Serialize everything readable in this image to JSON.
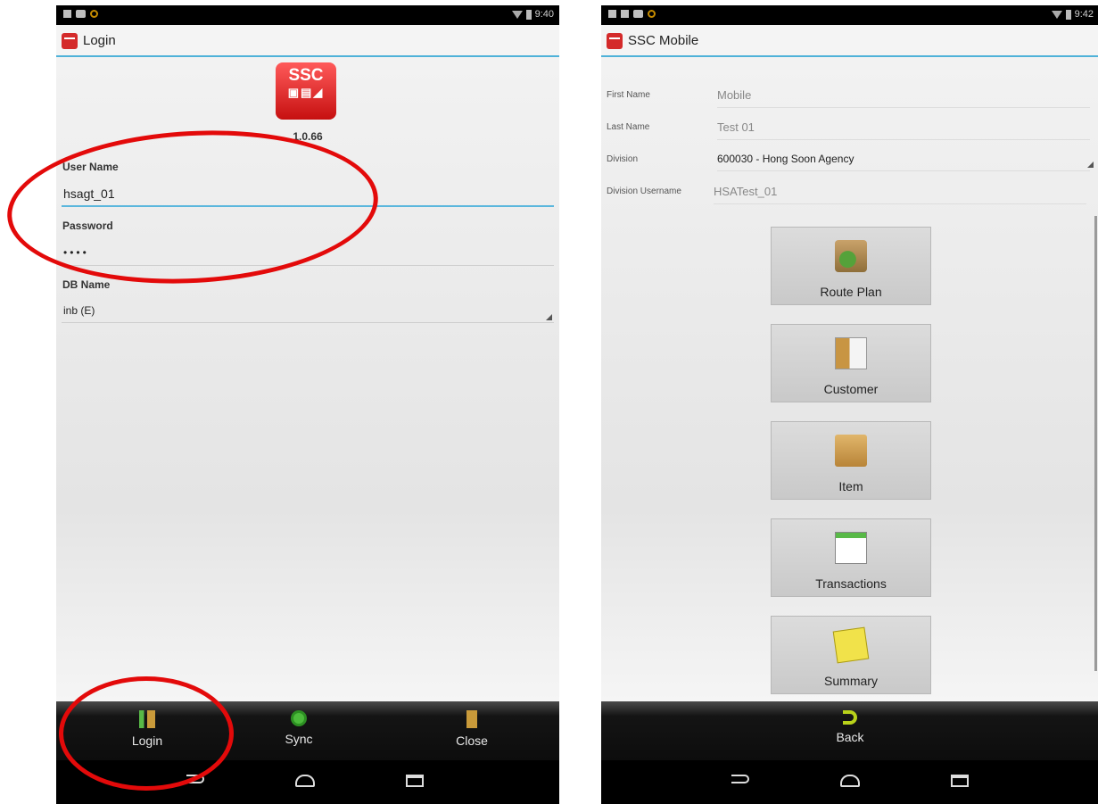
{
  "left": {
    "statusbar": {
      "time": "9:40"
    },
    "actionbar": {
      "title": "Login"
    },
    "logo": {
      "text": "SSC"
    },
    "version": "1.0.66",
    "form": {
      "username_label": "User Name",
      "username_value": "hsagt_01",
      "password_label": "Password",
      "password_value": "••••",
      "dbname_label": "DB Name",
      "dbname_value": "inb (E)"
    },
    "bottom": {
      "login": "Login",
      "sync": "Sync",
      "close": "Close"
    }
  },
  "right": {
    "statusbar": {
      "time": "9:42"
    },
    "actionbar": {
      "title": "SSC Mobile"
    },
    "info": {
      "first_name_label": "First Name",
      "first_name_value": "Mobile",
      "last_name_label": "Last Name",
      "last_name_value": "Test 01",
      "division_label": "Division",
      "division_value": "600030 - Hong Soon Agency",
      "division_username_label": "Division Username",
      "division_username_value": "HSATest_01"
    },
    "menu": {
      "route_plan": "Route Plan",
      "customer": "Customer",
      "item": "Item",
      "transactions": "Transactions",
      "summary": "Summary"
    },
    "bottom": {
      "back": "Back"
    }
  },
  "colors": {
    "annotation": "#e30a0a",
    "accent": "#4fb2d9",
    "brand": "#d42a2a"
  },
  "icons": [
    "login-door-icon",
    "sync-icon",
    "close-door-icon",
    "back-arrow-icon",
    "route-plan-icon",
    "customer-card-icon",
    "item-box-icon",
    "transactions-sheet-icon",
    "summary-note-icon"
  ]
}
